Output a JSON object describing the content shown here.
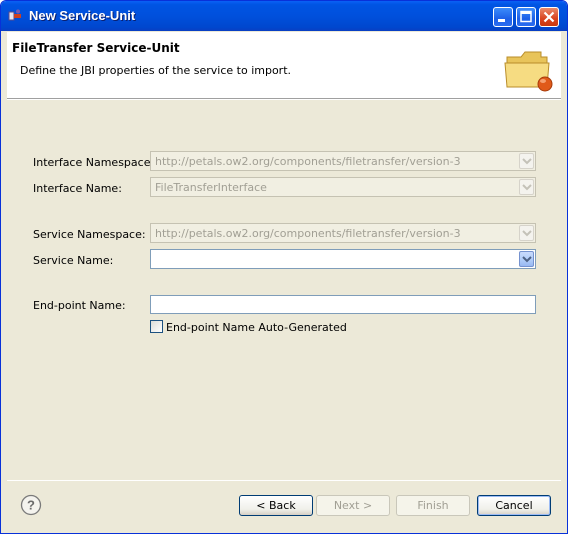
{
  "window": {
    "title": "New Service-Unit"
  },
  "header": {
    "title": "FileTransfer Service-Unit",
    "description": "Define the JBI properties of the service to import."
  },
  "form": {
    "interface_namespace": {
      "label": "Interface Namespace:",
      "value": "http://petals.ow2.org/components/filetransfer/version-3",
      "enabled": false
    },
    "interface_name": {
      "label": "Interface Name:",
      "value": "FileTransferInterface",
      "enabled": false
    },
    "service_namespace": {
      "label": "Service Namespace:",
      "value": "http://petals.ow2.org/components/filetransfer/version-3",
      "enabled": false
    },
    "service_name": {
      "label": "Service Name:",
      "value": "",
      "enabled": true
    },
    "endpoint_name": {
      "label": "End-point Name:",
      "value": ""
    },
    "endpoint_autogen": {
      "label": "End-point Name Auto-Generated",
      "checked": false
    }
  },
  "buttons": {
    "back": "< Back",
    "next": "Next >",
    "finish": "Finish",
    "cancel": "Cancel"
  },
  "icons": {
    "app": "eclipse-app-icon",
    "minimize": "minimize-icon",
    "maximize": "maximize-icon",
    "close": "close-icon",
    "banner": "folder-icon",
    "help": "help-icon",
    "dropdown": "chevron-down-icon"
  },
  "colors": {
    "titlebar": "#0054e3",
    "close_button": "#d9431f",
    "dialog_bg": "#ece9d8",
    "field_border": "#7f9db9",
    "disabled_text": "#a19f94"
  }
}
